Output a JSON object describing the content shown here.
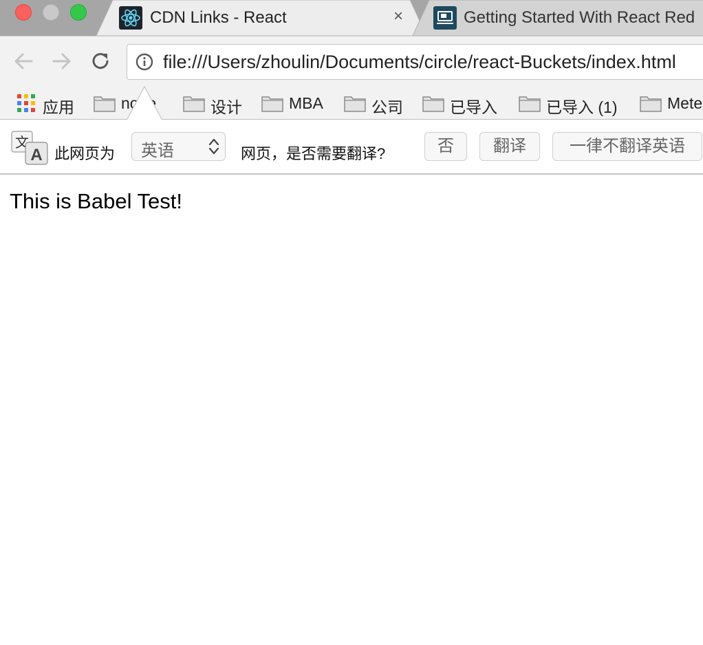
{
  "tabs": [
    {
      "title": "CDN Links - React",
      "favicon": "react-logo-icon",
      "active": true,
      "close_label": "×"
    },
    {
      "title": "Getting Started With React Red",
      "favicon": "monitor-icon",
      "active": false
    }
  ],
  "toolbar": {
    "url": "file:///Users/zhoulin/Documents/circle/react-Buckets/index.html"
  },
  "bookmarks": [
    {
      "label": "应用",
      "icon": "apps-grid-icon"
    },
    {
      "label": "node",
      "icon": "folder-icon"
    },
    {
      "label": "设计",
      "icon": "folder-icon"
    },
    {
      "label": "MBA",
      "icon": "folder-icon"
    },
    {
      "label": "公司",
      "icon": "folder-icon"
    },
    {
      "label": "已导入",
      "icon": "folder-icon"
    },
    {
      "label": "已导入 (1)",
      "icon": "folder-icon"
    },
    {
      "label": "Meteor",
      "icon": "folder-icon"
    }
  ],
  "translate": {
    "prefix": "此网页为",
    "language": "英语",
    "question": "网页，是否需要翻译?",
    "no_label": "否",
    "translate_label": "翻译",
    "never_label": "一律不翻译英语"
  },
  "page": {
    "text": "This is Babel Test!"
  }
}
